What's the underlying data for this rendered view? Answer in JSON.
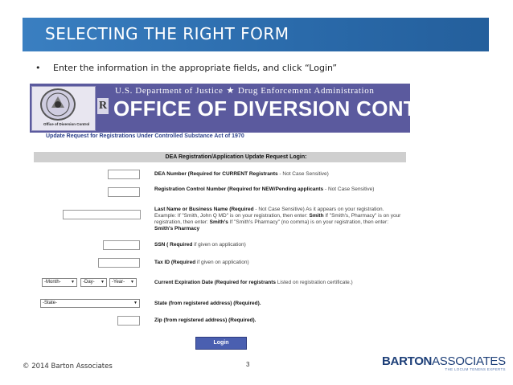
{
  "slide": {
    "title": "SELECTING THE RIGHT FORM",
    "bullet": "•",
    "instruction": "Enter the information in the appropriate fields, and click “Login”",
    "page_number": "3",
    "copyright": "© 2014 Barton Associates",
    "brand": {
      "name_bold": "BARTON",
      "name_light": "ASSOCIATES",
      "tagline": "THE LOCUM TENENS EXPERTS"
    }
  },
  "screenshot": {
    "banner_top_left": "U.S. Department of Justice",
    "banner_top_right": "Drug Enforcement Administration",
    "banner_main": "OFFICE OF DIVERSION CONTROL",
    "logo_letter": "R",
    "seal_caption": "Office of Diversion Control",
    "subtitle": "Update Request for Registrations Under Controlled Substance Act of 1970",
    "form": {
      "header": "DEA Registration/Application Update Request Login:",
      "fields": {
        "dea_number": {
          "label": "DEA Number (Required for CURRENT Registrants",
          "note": " - Not Case Sensitive)",
          "value": ""
        },
        "control_number": {
          "label": "Registration Control Number (Required for NEW/Pending applicants",
          "note": " - Not Case Sensitive)",
          "value": ""
        },
        "last_name": {
          "label": "Last Name or Business Name (Required",
          "note1": " - Not Case Sensitive) As it appears on your registration. Example: If \"Smith, John Q MD\" is on your registration, then enter: ",
          "ex1": "Smith",
          "note2": " If \"Smith's, Pharmacy\" is on your registration, then enter: ",
          "ex2": "Smith's",
          "note3": " If \"Smith's Pharmacy\" (no comma) is on your registration, then enter: ",
          "ex3": "Smith's Pharmacy",
          "value": ""
        },
        "ssn": {
          "label": "SSN ( Required",
          "note": " if given on application)",
          "value": ""
        },
        "tax_id": {
          "label": "Tax ID (Required",
          "note": " if given on application)",
          "value": ""
        },
        "expiration": {
          "month": "-Month-",
          "day": "-Day-",
          "year": "-Year-",
          "label": "Current Expiration Date (Required for registrants",
          "note": " Listed on registration certificate.)"
        },
        "state": {
          "selected": "-State-",
          "label": "State (from registered address) (Required)."
        },
        "zip": {
          "label": "Zip (from registered address) (Required).",
          "value": ""
        }
      },
      "login_label": "Login"
    }
  },
  "colors": {
    "header_blue": "#2a6aaa",
    "banner_purple": "#5b5a9e",
    "brand_blue": "#1d3f78",
    "button_blue": "#4a5fb0"
  }
}
